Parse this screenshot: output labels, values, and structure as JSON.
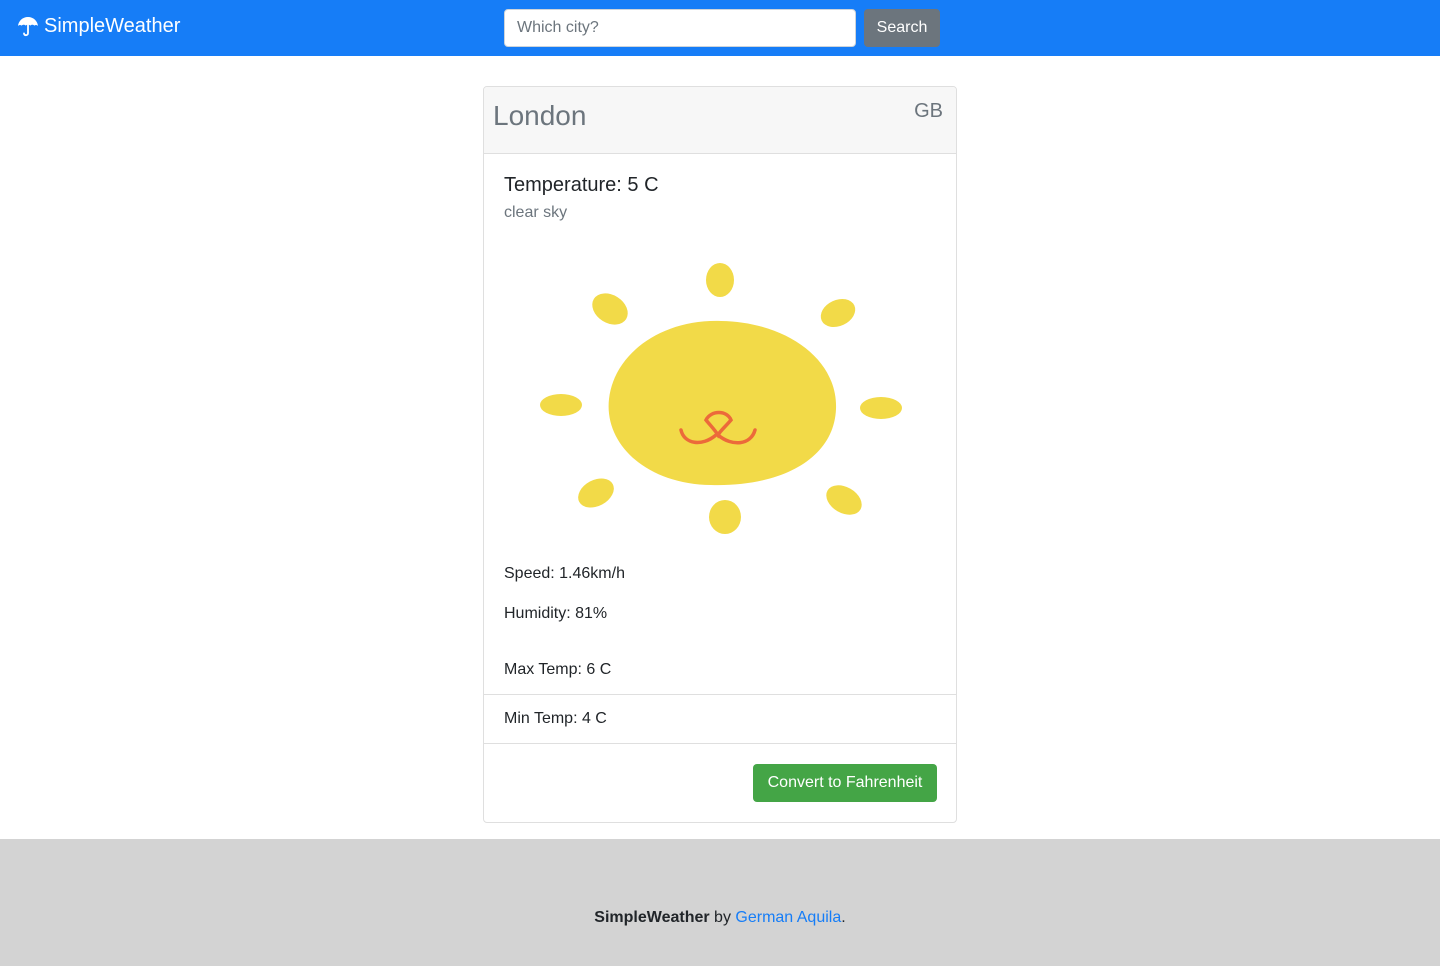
{
  "navbar": {
    "brand": "SimpleWeather",
    "brand_icon": "umbrella-icon",
    "search_placeholder": "Which city?",
    "search_value": "",
    "search_button": "Search",
    "color": "#167df7"
  },
  "card": {
    "city": "London",
    "country": "GB",
    "temperature": "Temperature: 5 C",
    "description": "clear sky",
    "weather_icon": "sun-icon",
    "speed": "Speed: 1.46km/h",
    "humidity": "Humidity: 81%",
    "max_temp": "Max Temp: 6 C",
    "min_temp": "Min Temp: 4 C",
    "convert_button": "Convert to Fahrenheit",
    "convert_color": "#44a546"
  },
  "footer": {
    "app_name": "SimpleWeather",
    "by": " by ",
    "author": "German Aquila",
    "period": ".",
    "background": "#d3d3d3"
  }
}
